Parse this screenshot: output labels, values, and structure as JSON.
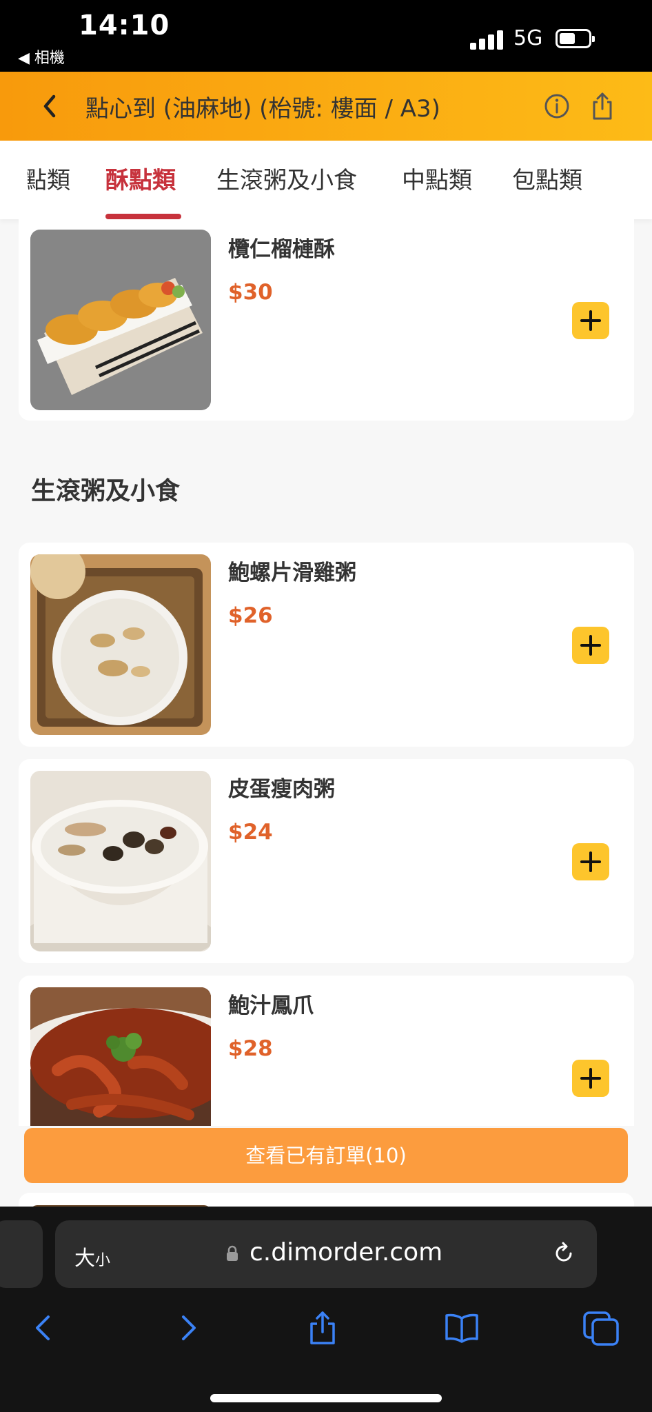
{
  "status": {
    "time": "14:10",
    "back_app": "◀ 相機",
    "network": "5G"
  },
  "header": {
    "title": "點心到 (油麻地) (枱號: 樓面 / A3)"
  },
  "tabs": [
    "點類",
    "酥點類",
    "生滾粥及小食",
    "中點類",
    "包點類"
  ],
  "active_tab": "酥點類",
  "items_top": [
    {
      "name": "欖仁榴槤酥",
      "price": "$30"
    }
  ],
  "section": {
    "title": "生滾粥及小食"
  },
  "items": [
    {
      "name": "鮑螺片滑雞粥",
      "price": "$26"
    },
    {
      "name": "皮蛋瘦肉粥",
      "price": "$24"
    },
    {
      "name": "鮑汁鳳爪",
      "price": "$28"
    }
  ],
  "order_bar": {
    "label": "查看已有訂單(10)"
  },
  "browser": {
    "text_size": "大",
    "text_size_small": "小",
    "url": "c.dimorder.com"
  },
  "colors": {
    "header_start": "#f89a0c",
    "header_end": "#fdbb17",
    "active_tab": "#c7323c",
    "price": "#e0622a",
    "add_button": "#fdc52c",
    "order_bar": "#fc9c3e"
  }
}
